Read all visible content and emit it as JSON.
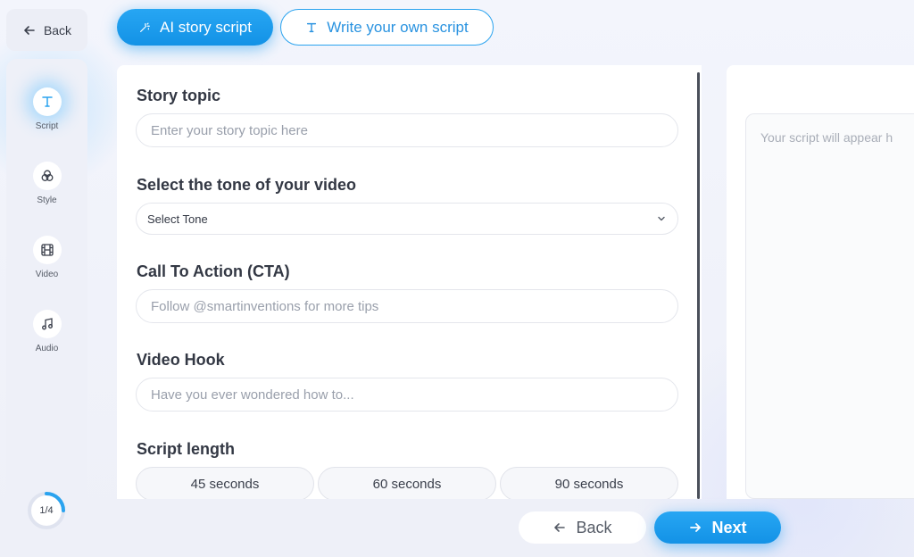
{
  "top_back": {
    "label": "Back"
  },
  "sidebar": {
    "items": [
      {
        "label": "Script",
        "icon": "text-t-icon",
        "active": true
      },
      {
        "label": "Style",
        "icon": "circles-icon",
        "active": false
      },
      {
        "label": "Video",
        "icon": "film-icon",
        "active": false
      },
      {
        "label": "Audio",
        "icon": "music-note-icon",
        "active": false
      }
    ],
    "progress": {
      "text": "1/4",
      "fraction": 0.25
    }
  },
  "tabs": {
    "ai": "AI story script",
    "own": "Write your own script"
  },
  "form": {
    "story_topic": {
      "label": "Story topic",
      "placeholder": "Enter your story topic here"
    },
    "tone": {
      "label": "Select the tone of your video",
      "value": "Select Tone"
    },
    "cta": {
      "label": "Call To Action (CTA)",
      "placeholder": "Follow @smartinventions for more tips"
    },
    "hook": {
      "label": "Video Hook",
      "placeholder": "Have you ever wondered how to..."
    },
    "length": {
      "label": "Script length",
      "options": [
        "45 seconds",
        "60 seconds",
        "90 seconds"
      ]
    }
  },
  "script_panel": {
    "placeholder": "Your script will appear h"
  },
  "footer": {
    "back": "Back",
    "next": "Next"
  },
  "colors": {
    "accent": "#1fa0ef",
    "background": "#f4f5fb"
  }
}
